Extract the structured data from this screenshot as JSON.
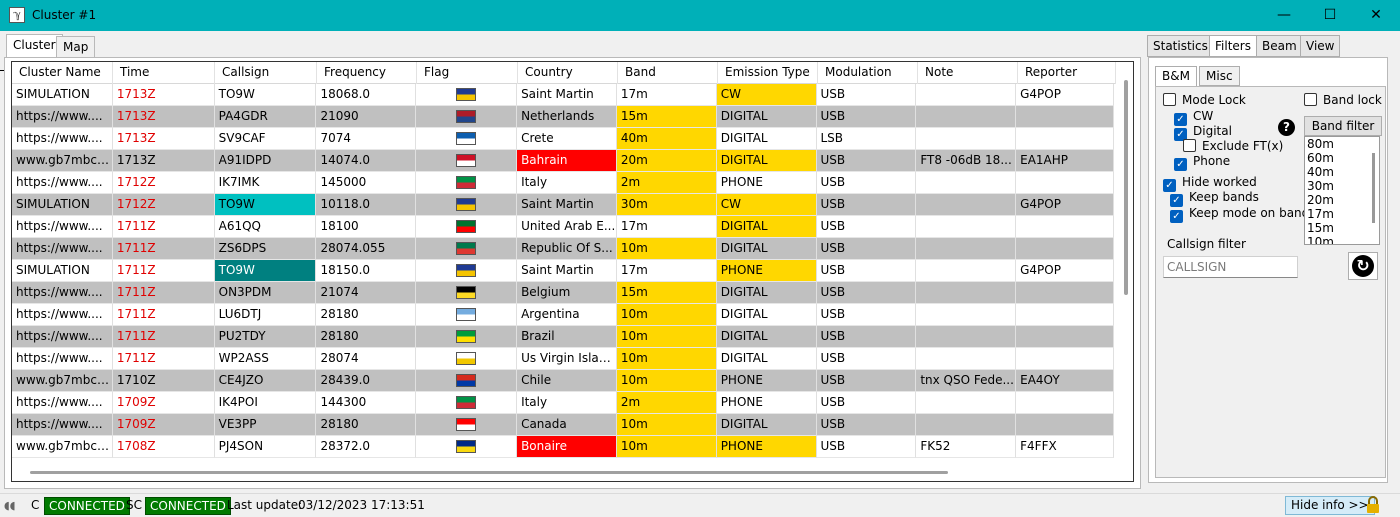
{
  "window": {
    "title": "Cluster #1",
    "icon": "antenna-icon",
    "controls": [
      "minimize-icon",
      "maximize-icon",
      "close-icon"
    ]
  },
  "main_tabs": [
    {
      "label": "Cluster",
      "active": true
    },
    {
      "label": "Map",
      "active": false
    }
  ],
  "grid": {
    "columns": [
      "Cluster Name",
      "Time",
      "Callsign",
      "Frequency",
      "Flag",
      "Country",
      "Band",
      "Emission Type",
      "Modulation",
      "Note",
      "Reporter"
    ],
    "rows": [
      {
        "cluster": "SIMULATION",
        "time": "1713Z",
        "time_red": true,
        "callsign": "TO9W",
        "freq": "18068.0",
        "flag": [
          "#1f3a93",
          "#f5c400"
        ],
        "country": "Saint Martin",
        "country_hl": "",
        "band": "17m",
        "band_hl": false,
        "emission": "CW",
        "emission_hl": true,
        "mod": "USB",
        "note": "",
        "reporter": "G4POP",
        "alt": false,
        "call_hl": ""
      },
      {
        "cluster": "https://www....",
        "time": "1713Z",
        "time_red": true,
        "callsign": "PA4GDR",
        "freq": "21090",
        "flag": [
          "#ae1c28",
          "#21468b"
        ],
        "country": "Netherlands",
        "country_hl": "",
        "band": "15m",
        "band_hl": true,
        "emission": "DIGITAL",
        "emission_hl": false,
        "mod": "USB",
        "note": "",
        "reporter": "",
        "alt": true,
        "call_hl": ""
      },
      {
        "cluster": "https://www....",
        "time": "1713Z",
        "time_red": true,
        "callsign": "SV9CAF",
        "freq": "7074",
        "flag": [
          "#0d5eaf",
          "#ffffff"
        ],
        "country": "Crete",
        "country_hl": "",
        "band": "40m",
        "band_hl": true,
        "emission": "DIGITAL",
        "emission_hl": false,
        "mod": "LSB",
        "note": "",
        "reporter": "",
        "alt": false,
        "call_hl": ""
      },
      {
        "cluster": "www.gb7mbc....",
        "time": "1713Z",
        "time_red": false,
        "callsign": "A91IDPD",
        "freq": "14074.0",
        "flag": [
          "#ce1126",
          "#ffffff"
        ],
        "country": "Bahrain",
        "country_hl": "red",
        "band": "20m",
        "band_hl": true,
        "emission": "DIGITAL",
        "emission_hl": true,
        "mod": "USB",
        "note": "FT8 -06dB 18...",
        "reporter": "EA1AHP",
        "alt": true,
        "call_hl": ""
      },
      {
        "cluster": "https://www....",
        "time": "1712Z",
        "time_red": true,
        "callsign": "IK7IMK",
        "freq": "145000",
        "flag": [
          "#009246",
          "#ce2b37"
        ],
        "country": "Italy",
        "country_hl": "",
        "band": "2m",
        "band_hl": true,
        "emission": "PHONE",
        "emission_hl": false,
        "mod": "USB",
        "note": "",
        "reporter": "",
        "alt": false,
        "call_hl": ""
      },
      {
        "cluster": "SIMULATION",
        "time": "1712Z",
        "time_red": true,
        "callsign": "TO9W",
        "freq": "10118.0",
        "flag": [
          "#1f3a93",
          "#f5c400"
        ],
        "country": "Saint Martin",
        "country_hl": "",
        "band": "30m",
        "band_hl": true,
        "emission": "CW",
        "emission_hl": true,
        "mod": "USB",
        "note": "",
        "reporter": "G4POP",
        "alt": true,
        "call_hl": "cyan"
      },
      {
        "cluster": "https://www....",
        "time": "1711Z",
        "time_red": true,
        "callsign": "A61QQ",
        "freq": "18100",
        "flag": [
          "#00732f",
          "#ff0000"
        ],
        "country": "United Arab E...",
        "country_hl": "",
        "band": "17m",
        "band_hl": false,
        "emission": "DIGITAL",
        "emission_hl": true,
        "mod": "USB",
        "note": "",
        "reporter": "",
        "alt": false,
        "call_hl": ""
      },
      {
        "cluster": "https://www....",
        "time": "1711Z",
        "time_red": true,
        "callsign": "ZS6DPS",
        "freq": "28074.055",
        "flag": [
          "#007a4d",
          "#de3831"
        ],
        "country": "Republic Of S...",
        "country_hl": "",
        "band": "10m",
        "band_hl": true,
        "emission": "DIGITAL",
        "emission_hl": false,
        "mod": "USB",
        "note": "",
        "reporter": "",
        "alt": true,
        "call_hl": ""
      },
      {
        "cluster": "SIMULATION",
        "time": "1711Z",
        "time_red": true,
        "callsign": "TO9W",
        "freq": "18150.0",
        "flag": [
          "#1f3a93",
          "#f5c400"
        ],
        "country": "Saint Martin",
        "country_hl": "",
        "band": "17m",
        "band_hl": false,
        "emission": "PHONE",
        "emission_hl": true,
        "mod": "USB",
        "note": "",
        "reporter": "G4POP",
        "alt": false,
        "call_hl": "teal"
      },
      {
        "cluster": "https://www....",
        "time": "1711Z",
        "time_red": true,
        "callsign": "ON3PDM",
        "freq": "21074",
        "flag": [
          "#000000",
          "#fdda24"
        ],
        "country": "Belgium",
        "country_hl": "",
        "band": "15m",
        "band_hl": true,
        "emission": "DIGITAL",
        "emission_hl": false,
        "mod": "USB",
        "note": "",
        "reporter": "",
        "alt": true,
        "call_hl": ""
      },
      {
        "cluster": "https://www....",
        "time": "1711Z",
        "time_red": true,
        "callsign": "LU6DTJ",
        "freq": "28180",
        "flag": [
          "#74acdf",
          "#ffffff"
        ],
        "country": "Argentina",
        "country_hl": "",
        "band": "10m",
        "band_hl": true,
        "emission": "DIGITAL",
        "emission_hl": false,
        "mod": "USB",
        "note": "",
        "reporter": "",
        "alt": false,
        "call_hl": ""
      },
      {
        "cluster": "https://www....",
        "time": "1711Z",
        "time_red": true,
        "callsign": "PU2TDY",
        "freq": "28180",
        "flag": [
          "#009c3b",
          "#ffdf00"
        ],
        "country": "Brazil",
        "country_hl": "",
        "band": "10m",
        "band_hl": true,
        "emission": "DIGITAL",
        "emission_hl": false,
        "mod": "USB",
        "note": "",
        "reporter": "",
        "alt": true,
        "call_hl": ""
      },
      {
        "cluster": "https://www....",
        "time": "1711Z",
        "time_red": true,
        "callsign": "WP2ASS",
        "freq": "28074",
        "flag": [
          "#ffffff",
          "#f1c700"
        ],
        "country": "Us Virgin Islands",
        "country_hl": "",
        "band": "10m",
        "band_hl": true,
        "emission": "DIGITAL",
        "emission_hl": false,
        "mod": "USB",
        "note": "",
        "reporter": "",
        "alt": false,
        "call_hl": ""
      },
      {
        "cluster": "www.gb7mbc....",
        "time": "1710Z",
        "time_red": false,
        "callsign": "CE4JZO",
        "freq": "28439.0",
        "flag": [
          "#d52b1e",
          "#0039a6"
        ],
        "country": "Chile",
        "country_hl": "",
        "band": "10m",
        "band_hl": true,
        "emission": "PHONE",
        "emission_hl": false,
        "mod": "USB",
        "note": "tnx QSO Fede...",
        "reporter": "EA4OY",
        "alt": true,
        "call_hl": ""
      },
      {
        "cluster": "https://www....",
        "time": "1709Z",
        "time_red": true,
        "callsign": "IK4POI",
        "freq": "144300",
        "flag": [
          "#009246",
          "#ce2b37"
        ],
        "country": "Italy",
        "country_hl": "",
        "band": "2m",
        "band_hl": true,
        "emission": "PHONE",
        "emission_hl": false,
        "mod": "USB",
        "note": "",
        "reporter": "",
        "alt": false,
        "call_hl": ""
      },
      {
        "cluster": "https://www....",
        "time": "1709Z",
        "time_red": true,
        "callsign": "VE3PP",
        "freq": "28180",
        "flag": [
          "#ff0000",
          "#ffffff"
        ],
        "country": "Canada",
        "country_hl": "",
        "band": "10m",
        "band_hl": true,
        "emission": "DIGITAL",
        "emission_hl": false,
        "mod": "USB",
        "note": "",
        "reporter": "",
        "alt": true,
        "call_hl": ""
      },
      {
        "cluster": "www.gb7mbc....",
        "time": "1708Z",
        "time_red": true,
        "callsign": "PJ4SON",
        "freq": "28372.0",
        "flag": [
          "#012a87",
          "#f9d90f"
        ],
        "country": "Bonaire",
        "country_hl": "red",
        "band": "10m",
        "band_hl": true,
        "emission": "PHONE",
        "emission_hl": true,
        "mod": "USB",
        "note": "FK52",
        "reporter": "F4FFX",
        "alt": false,
        "call_hl": ""
      }
    ]
  },
  "right_tabs": [
    {
      "label": "Statistics",
      "active": false
    },
    {
      "label": "Filters",
      "active": true
    },
    {
      "label": "Beam",
      "active": false
    },
    {
      "label": "View",
      "active": false
    }
  ],
  "sub_tabs": [
    {
      "label": "B&M",
      "active": true
    },
    {
      "label": "Misc",
      "active": false
    }
  ],
  "filters": {
    "mode_lock": {
      "label": "Mode Lock",
      "checked": false
    },
    "band_lock": {
      "label": "Band lock",
      "checked": false
    },
    "cw": {
      "label": "CW",
      "checked": true
    },
    "digital": {
      "label": "Digital",
      "checked": true
    },
    "exclude_ft": {
      "label": "Exclude FT(x)",
      "checked": false
    },
    "phone": {
      "label": "Phone",
      "checked": true
    },
    "hide_worked": {
      "label": "Hide worked",
      "checked": true
    },
    "keep_bands": {
      "label": "Keep bands",
      "checked": true
    },
    "keep_mode": {
      "label": "Keep mode on band",
      "checked": true
    },
    "help_icon": "question-icon",
    "band_filter_label": "Band filter",
    "bands": [
      "80m",
      "60m",
      "40m",
      "30m",
      "20m",
      "17m",
      "15m",
      "10m"
    ],
    "callsign_filter_label": "Callsign filter",
    "callsign_placeholder": "CALLSIGN",
    "refresh_icon": "refresh-icon"
  },
  "statusbar": {
    "c_label": "C",
    "c_status": "CONNECTED",
    "sc_label": "SC",
    "sc_status": "CONNECTED",
    "last_update_label": "Last update:",
    "last_update": "03/12/2023 17:13:51",
    "hide_info": "Hide info >>",
    "colors": {
      "connected": "#007a00",
      "accent": "#00b0b8"
    }
  }
}
